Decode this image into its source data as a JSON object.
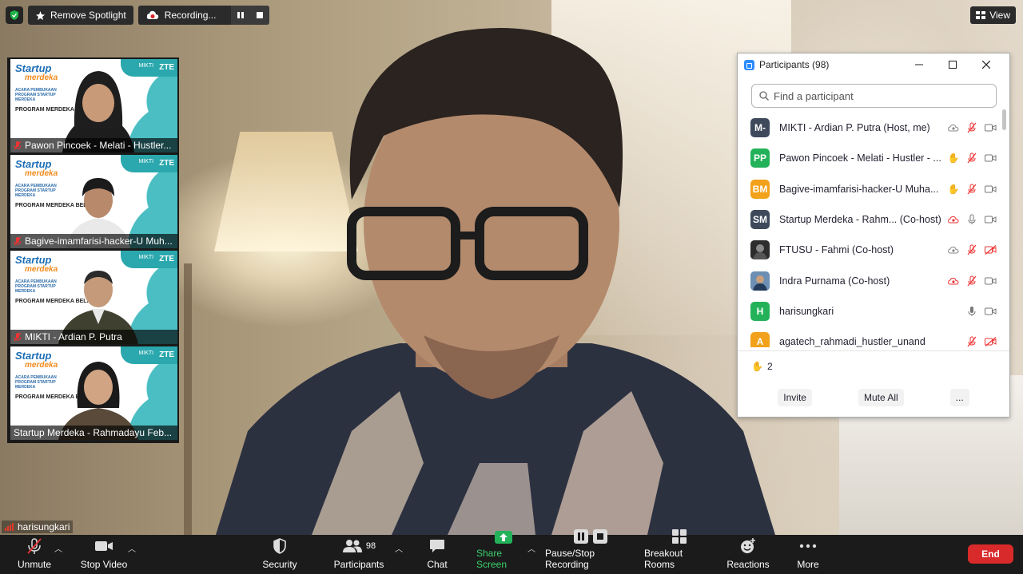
{
  "topbar": {
    "spotlight_label": "Remove Spotlight",
    "recording_label": "Recording...",
    "view_label": "View"
  },
  "thumbnails": [
    {
      "caption": "Pawon Pincoek - Melati - Hustler...",
      "muted": true
    },
    {
      "caption": "Bagive-imamfarisi-hacker-U Muh...",
      "muted": true
    },
    {
      "caption": "MIKTI - Ardian P. Putra",
      "muted": true
    },
    {
      "caption": "Startup Merdeka - Rahmadayu Feb...",
      "muted": false
    }
  ],
  "slide": {
    "logo_top": "Startup",
    "logo_bottom": "merdeka",
    "brand_mikti": "MIKTI",
    "brand_zte": "ZTE",
    "acara": "ACARA PEMBUKAAN PROGRAM STARTUP MERDEKA",
    "program": "PROGRAM MERDEKA BELAJAR"
  },
  "active_speaker": "harisungkari",
  "participants_panel": {
    "title": "Participants (98)",
    "search_placeholder": "Find a participant",
    "participants": [
      {
        "initials": "M-",
        "color": "#3e4a5c",
        "name": "MIKTI - Ardian P. Putra (Host, me)"
      },
      {
        "initials": "PP",
        "color": "#23b25a",
        "name": "Pawon Pincoek - Melati - Hustler - ..."
      },
      {
        "initials": "BM",
        "color": "#f2a11b",
        "name": "Bagive-imamfarisi-hacker-U Muha..."
      },
      {
        "initials": "SM",
        "color": "#3e4a5c",
        "name": "Startup Merdeka - Rahm...  (Co-host)"
      },
      {
        "initials": "",
        "color": "#333333",
        "name": "FTUSU - Fahmi (Co-host)"
      },
      {
        "initials": "",
        "color": "#4a6a8a",
        "name": "Indra Purnama (Co-host)"
      },
      {
        "initials": "H",
        "color": "#23b25a",
        "name": "harisungkari"
      },
      {
        "initials": "A",
        "color": "#f2a11b",
        "name": "agatech_rahmadi_hustler_unand"
      }
    ],
    "raised_hands_count": "2",
    "invite_label": "Invite",
    "mute_all_label": "Mute All",
    "more_label": "..."
  },
  "toolbar": {
    "unmute": "Unmute",
    "stop_video": "Stop Video",
    "security": "Security",
    "participants": "Participants",
    "participants_count": "98",
    "chat": "Chat",
    "share_screen": "Share Screen",
    "pause_recording": "Pause/Stop Recording",
    "breakout_rooms": "Breakout Rooms",
    "reactions": "Reactions",
    "more": "More",
    "end": "End"
  }
}
